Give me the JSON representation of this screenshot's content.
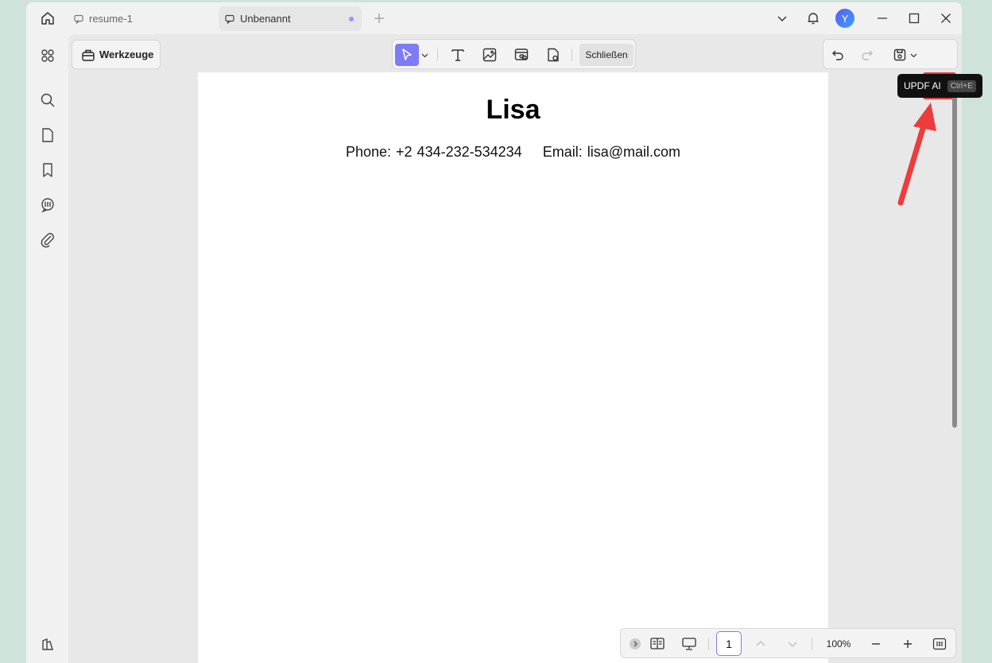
{
  "tabs": [
    {
      "label": "resume-1",
      "active": false
    },
    {
      "label": "Unbenannt",
      "active": true,
      "unsaved": true
    }
  ],
  "user": {
    "avatar_initial": "Y"
  },
  "toolbar": {
    "tools_label": "Werkzeuge",
    "close_label": "Schließen"
  },
  "ai": {
    "tooltip_label": "UPDF AI",
    "tooltip_shortcut": "Ctrl+E"
  },
  "document": {
    "name": "Lisa",
    "phone": "Phone: +2 434-232-534234",
    "email": "Email: lisa@mail.com"
  },
  "bottombar": {
    "page_number": "1",
    "zoom": "100%"
  },
  "colors": {
    "accent": "#7e7bf6",
    "highlight_red": "#ee3b3b",
    "background": "#cfe3da"
  }
}
